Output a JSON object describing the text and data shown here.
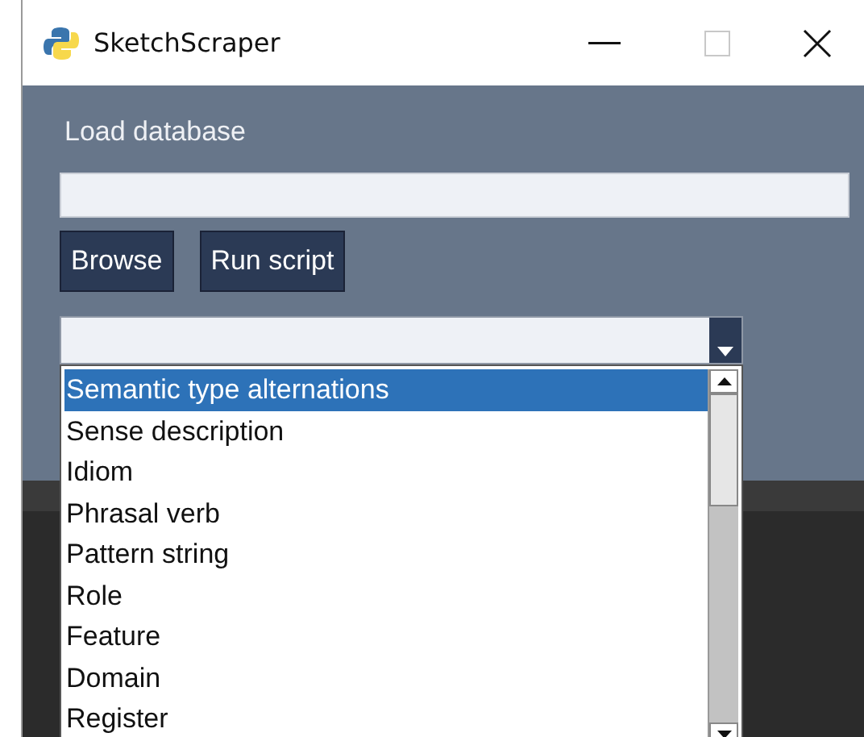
{
  "window": {
    "title": "SketchScraper"
  },
  "load_label": "Load database",
  "buttons": [
    "Browse",
    "Run script"
  ],
  "combo": {
    "expanded": true
  },
  "options": [
    {
      "label": "Semantic type alternations",
      "selected": true
    },
    {
      "label": "Sense description",
      "selected": false
    },
    {
      "label": "Idiom",
      "selected": false
    },
    {
      "label": "Phrasal verb",
      "selected": false
    },
    {
      "label": "Pattern string",
      "selected": false
    },
    {
      "label": "Role",
      "selected": false
    },
    {
      "label": "Feature",
      "selected": false
    },
    {
      "label": "Domain",
      "selected": false
    },
    {
      "label": "Register",
      "selected": false
    }
  ]
}
